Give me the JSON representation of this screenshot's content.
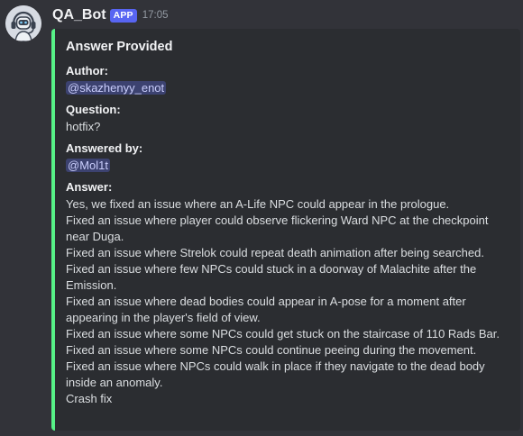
{
  "message": {
    "author_name": "QA_Bot",
    "badge": "APP",
    "timestamp": "17:05",
    "avatar_icon": "robot-headset-icon"
  },
  "embed": {
    "accent_color": "#57f287",
    "title": "Answer Provided",
    "fields": {
      "author": {
        "name": "Author:",
        "value": "@skazhenyy_enot"
      },
      "question": {
        "name": "Question:",
        "value": "hotfix?"
      },
      "answered_by": {
        "name": "Answered by:",
        "value": "@Mol1t"
      },
      "answer": {
        "name": "Answer:",
        "lines": [
          "Yes, we fixed an issue where an A-Life NPC could appear in the prologue.",
          "Fixed an issue where player could observe flickering Ward NPC at the checkpoint",
          "near Duga.",
          "Fixed an issue where Strelok could repeat death animation after being searched.",
          "Fixed an issue where few NPCs could stuck in a doorway of Malachite after the",
          "Emission.",
          "Fixed an issue where dead bodies could appear in A-pose for a moment after",
          "appearing in the player's field of view.",
          "Fixed an issue where some NPCs could get stuck on the staircase of 110 Rads Bar.",
          "Fixed an issue where some NPCs could continue peeing during the movement.",
          "Fixed an issue where NPCs could walk in place if they navigate to the dead body",
          "inside an anomaly.",
          "Crash fix"
        ]
      }
    }
  },
  "colors": {
    "background": "#323339",
    "embed_background": "#2b2d31",
    "badge": "#5865f2",
    "mention_background": "#3c4270"
  }
}
